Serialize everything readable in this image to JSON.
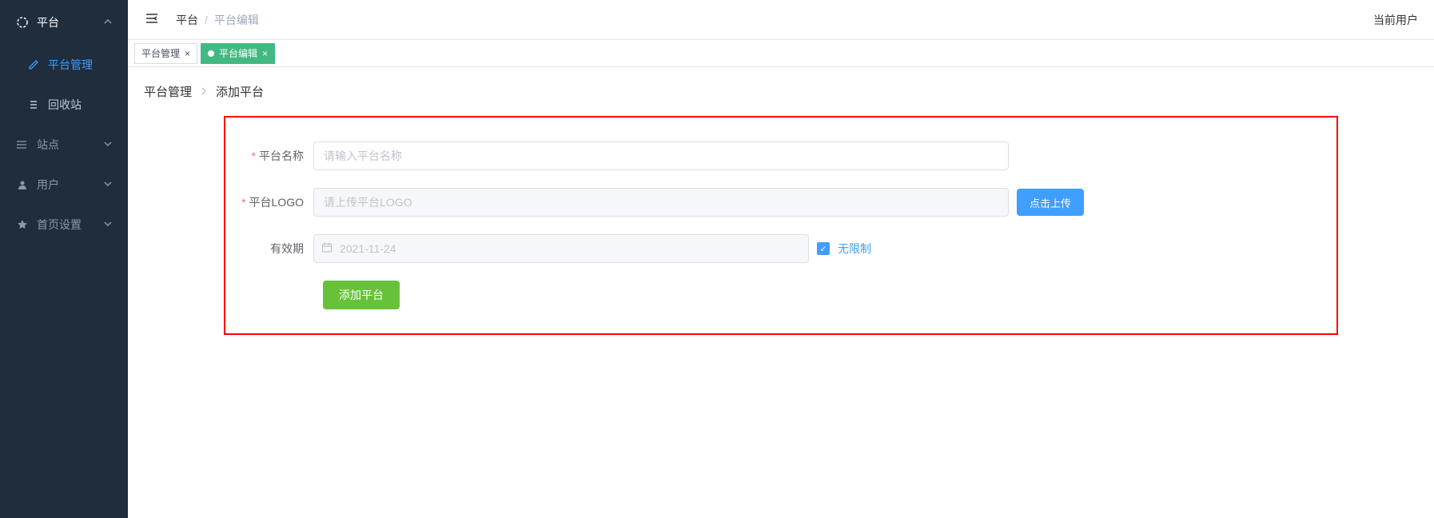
{
  "sidebar": {
    "groups": [
      {
        "label": "平台",
        "expanded": true,
        "items": [
          {
            "label": "平台管理",
            "active": true
          },
          {
            "label": "回收站",
            "active": false
          }
        ]
      },
      {
        "label": "站点",
        "expanded": false
      },
      {
        "label": "用户",
        "expanded": false
      },
      {
        "label": "首页设置",
        "expanded": false
      }
    ]
  },
  "topbar": {
    "breadcrumb_root": "平台",
    "breadcrumb_current": "平台编辑",
    "current_user_label": "当前用户"
  },
  "tabs": [
    {
      "label": "平台管理",
      "active": false
    },
    {
      "label": "平台编辑",
      "active": true
    }
  ],
  "content": {
    "breadcrumb_first": "平台管理",
    "breadcrumb_second": "添加平台",
    "form": {
      "name_label": "平台名称",
      "name_placeholder": "请输入平台名称",
      "name_value": "",
      "logo_label": "平台LOGO",
      "logo_placeholder": "请上传平台LOGO",
      "logo_value": "",
      "upload_button": "点击上传",
      "expiry_label": "有效期",
      "expiry_value": "2021-11-24",
      "unlimited_label": "无限制",
      "unlimited_checked": true,
      "submit_label": "添加平台"
    }
  }
}
